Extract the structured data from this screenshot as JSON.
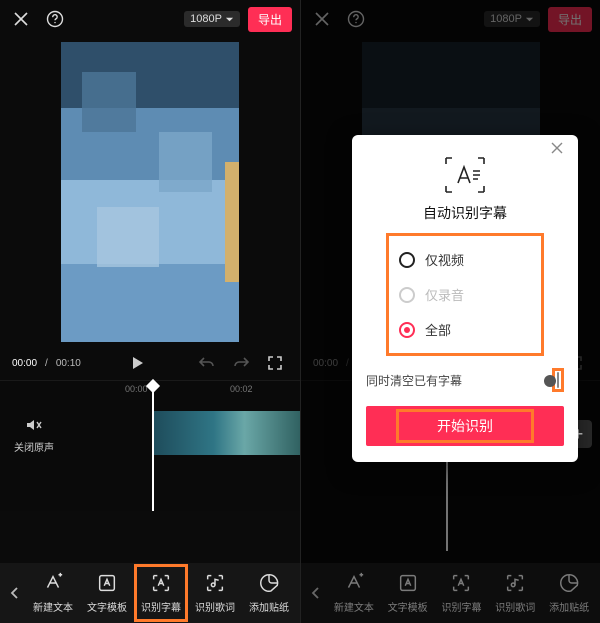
{
  "header": {
    "resolution": "1080P",
    "export": "导出"
  },
  "time": {
    "current": "00:00",
    "total": "00:10"
  },
  "ruler": {
    "t0": "00:00",
    "t1": "00:02"
  },
  "mute_label": "关闭原声",
  "tools": {
    "new_text": "新建文本",
    "template": "文字模板",
    "subtitle": "识别字幕",
    "lyrics": "识别歌词",
    "sticker": "添加贴纸"
  },
  "modal": {
    "title": "自动识别字幕",
    "opt_video": "仅视频",
    "opt_audio": "仅录音",
    "opt_all": "全部",
    "clear_label": "同时清空已有字幕",
    "action": "开始识别"
  }
}
